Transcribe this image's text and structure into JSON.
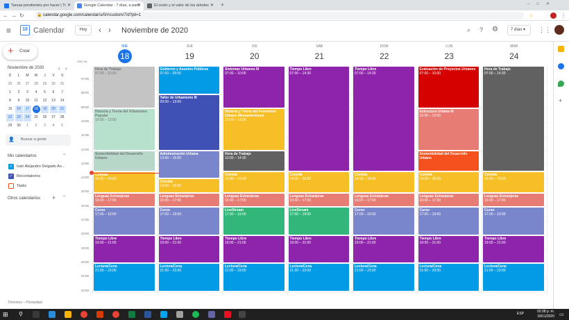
{
  "browser": {
    "tabs": [
      {
        "title": "Tareas pendientes por hacer | Tr"
      },
      {
        "title": "Google Calendar - 7 días, a parti"
      },
      {
        "title": "El costo y el valor de los árboles"
      }
    ],
    "url": "calendar.google.com/calendar/u/0/r/custom/7/d?pli=1"
  },
  "header": {
    "app": "Calendar",
    "today": "Hoy",
    "prev": "‹",
    "next": "›",
    "title": "Noviembre de 2020",
    "view": "7 días"
  },
  "sidebar": {
    "create": "Crear",
    "mini_title": "Noviembre de 2020",
    "weekdays": [
      "D",
      "L",
      "M",
      "M",
      "J",
      "V",
      "S"
    ],
    "weeks": [
      [
        "25",
        "26",
        "27",
        "28",
        "29",
        "30",
        "31"
      ],
      [
        "1",
        "2",
        "3",
        "4",
        "5",
        "6",
        "7"
      ],
      [
        "8",
        "9",
        "10",
        "11",
        "12",
        "13",
        "14"
      ],
      [
        "15",
        "16",
        "17",
        "18",
        "19",
        "20",
        "21"
      ],
      [
        "22",
        "23",
        "24",
        "25",
        "26",
        "27",
        "28"
      ],
      [
        "29",
        "30",
        "1",
        "2",
        "3",
        "4",
        "5"
      ]
    ],
    "search": "Buscar a gente",
    "my_calendars": "Mis calendarios",
    "cals": [
      "Iván Alejandro Delgado An...",
      "Recordatorios",
      "Tasks"
    ],
    "other_calendars": "Otros calendarios",
    "footer": "Términos – Privacidad"
  },
  "tz": "GMT-06",
  "days": [
    {
      "name": "MIÉ",
      "num": "18"
    },
    {
      "name": "JUE",
      "num": "19"
    },
    {
      "name": "VIE",
      "num": "20"
    },
    {
      "name": "SÁB",
      "num": "21"
    },
    {
      "name": "DOM",
      "num": "22"
    },
    {
      "name": "LUN",
      "num": "23"
    },
    {
      "name": "MAR",
      "num": "24"
    }
  ],
  "times": [
    "07:00",
    "08:00",
    "09:00",
    "10:00",
    "11:00",
    "12:00",
    "13:00",
    "14:00",
    "15:00",
    "16:00",
    "17:00",
    "18:00",
    "19:00",
    "20:00",
    "21:00",
    "22:00"
  ],
  "events": [
    {
      "day": 0,
      "start": 7,
      "end": 10,
      "title": "Hora de Trabajo",
      "time": "07:00 – 10:00",
      "color": "#c4c4c4",
      "faded": true
    },
    {
      "day": 0,
      "start": 10,
      "end": 13,
      "title": "Historia y Teoría del Urbanismo Popular",
      "time": "10:00 – 13:00",
      "color": "#b7e1cd",
      "faded": true
    },
    {
      "day": 0,
      "start": 13,
      "end": 14.5,
      "title": "Sostenibilidad del Desarrollo Urbano",
      "time": "",
      "color": "#b7d7c8",
      "faded": true
    },
    {
      "day": 0,
      "start": 14.5,
      "end": 16,
      "title": "Comida",
      "time": "14:30 – 16:00",
      "color": "#f6bf26"
    },
    {
      "day": 0,
      "start": 16,
      "end": 17,
      "title": "Lenguas Extranjeras",
      "time": "16:00 – 17:00",
      "color": "#e67c73"
    },
    {
      "day": 0,
      "start": 17,
      "end": 19,
      "title": "Curso",
      "time": "17:00 – 19:00",
      "color": "#7986cb"
    },
    {
      "day": 0,
      "start": 19,
      "end": 21,
      "title": "Tiempo Libre",
      "time": "19:00 – 21:00",
      "color": "#8e24aa"
    },
    {
      "day": 0,
      "start": 21,
      "end": 23,
      "title": "Lectura/Cena",
      "time": "21:00 – 23:00",
      "color": "#039be5"
    },
    {
      "day": 1,
      "start": 7,
      "end": 9,
      "title": "Gobierno y Asuntos Públicos",
      "time": "07:00 – 09:00",
      "color": "#039be5"
    },
    {
      "day": 1,
      "start": 9,
      "end": 13,
      "title": "Taller de Urbanismo III",
      "time": "09:00 – 13:00",
      "color": "#3f51b5"
    },
    {
      "day": 1,
      "start": 13,
      "end": 15,
      "title": "Administración Urbana",
      "time": "13:00 – 15:00",
      "color": "#7986cb"
    },
    {
      "day": 1,
      "start": 15,
      "end": 16,
      "title": "Comida",
      "time": "14:30 – 16:00",
      "color": "#f6bf26"
    },
    {
      "day": 1,
      "start": 16,
      "end": 17,
      "title": "Lenguas Extranjeras",
      "time": "16:00 – 17:00",
      "color": "#e67c73"
    },
    {
      "day": 1,
      "start": 17,
      "end": 19,
      "title": "Curso",
      "time": "17:00 – 19:00",
      "color": "#7986cb"
    },
    {
      "day": 1,
      "start": 19,
      "end": 21,
      "title": "Tiempo Libre",
      "time": "19:00 – 21:00",
      "color": "#8e24aa"
    },
    {
      "day": 1,
      "start": 21,
      "end": 23,
      "title": "Lectura/Cena",
      "time": "21:00 – 23:00",
      "color": "#039be5"
    },
    {
      "day": 2,
      "start": 7,
      "end": 10,
      "title": "Sistemas Urbanos III",
      "time": "07:00 – 10:00",
      "color": "#8e24aa"
    },
    {
      "day": 2,
      "start": 10,
      "end": 13,
      "title": "Historia y Teoría del Fenómeno Urbano Mesoamericano",
      "time": "10:00 – 13:00",
      "color": "#f6bf26"
    },
    {
      "day": 2,
      "start": 13,
      "end": 14.5,
      "title": "Hora de Trabajo",
      "time": "13:00 – 14:30",
      "color": "#616161"
    },
    {
      "day": 2,
      "start": 14.5,
      "end": 16,
      "title": "Comida",
      "time": "14:30 – 16:00",
      "color": "#f6bf26"
    },
    {
      "day": 2,
      "start": 16,
      "end": 17,
      "title": "Lenguas Extranjeras",
      "time": "16:00 – 17:00",
      "color": "#e67c73"
    },
    {
      "day": 2,
      "start": 17,
      "end": 19,
      "title": "LiveStream",
      "time": "17:00 – 19:00",
      "color": "#33b679"
    },
    {
      "day": 2,
      "start": 19,
      "end": 21,
      "title": "Tiempo Libre",
      "time": "19:00 – 21:00",
      "color": "#8e24aa"
    },
    {
      "day": 2,
      "start": 21,
      "end": 23,
      "title": "Lectura/Cena",
      "time": "21:00 – 23:00",
      "color": "#039be5"
    },
    {
      "day": 3,
      "start": 7,
      "end": 14.5,
      "title": "Tiempo Libre",
      "time": "07:00 – 14:30",
      "color": "#8e24aa"
    },
    {
      "day": 3,
      "start": 14.5,
      "end": 16,
      "title": "Comida",
      "time": "14:30 – 16:00",
      "color": "#f6bf26"
    },
    {
      "day": 3,
      "start": 16,
      "end": 17,
      "title": "Lenguas Extranjeras",
      "time": "16:00 – 17:00",
      "color": "#e67c73"
    },
    {
      "day": 3,
      "start": 17,
      "end": 19,
      "title": "LiveStream",
      "time": "17:00 – 19:00",
      "color": "#33b679"
    },
    {
      "day": 3,
      "start": 19,
      "end": 21,
      "title": "Tiempo Libre",
      "time": "19:00 – 21:00",
      "color": "#8e24aa"
    },
    {
      "day": 3,
      "start": 21,
      "end": 23,
      "title": "Lectura/Cena",
      "time": "21:00 – 23:00",
      "color": "#039be5"
    },
    {
      "day": 4,
      "start": 7,
      "end": 14.5,
      "title": "Tiempo Libre",
      "time": "07:00 – 14:30",
      "color": "#8e24aa"
    },
    {
      "day": 4,
      "start": 14.5,
      "end": 16,
      "title": "Comida",
      "time": "14:30 – 16:00",
      "color": "#f6bf26"
    },
    {
      "day": 4,
      "start": 16,
      "end": 17,
      "title": "Lenguas Extranjeras",
      "time": "16:00 – 17:00",
      "color": "#e67c73"
    },
    {
      "day": 4,
      "start": 17,
      "end": 19,
      "title": "Curso",
      "time": "17:00 – 19:00",
      "color": "#7986cb"
    },
    {
      "day": 4,
      "start": 19,
      "end": 21,
      "title": "Tiempo Libre",
      "time": "19:00 – 21:00",
      "color": "#8e24aa"
    },
    {
      "day": 4,
      "start": 21,
      "end": 23,
      "title": "Lectura/Cena",
      "time": "21:00 – 23:00",
      "color": "#039be5"
    },
    {
      "day": 5,
      "start": 7,
      "end": 10,
      "title": "Evaluación de Proyectos Urbanos",
      "time": "07:00 – 10:00",
      "color": "#d50000"
    },
    {
      "day": 5,
      "start": 10,
      "end": 13,
      "title": "Estructura Urbana III",
      "time": "10:00 – 13:00",
      "color": "#e67c73"
    },
    {
      "day": 5,
      "start": 13,
      "end": 14.5,
      "title": "Sostenibilidad del Desarrollo Urbano",
      "time": "",
      "color": "#f4511e"
    },
    {
      "day": 5,
      "start": 14.5,
      "end": 16,
      "title": "Comida",
      "time": "14:30 – 16:00",
      "color": "#f6bf26"
    },
    {
      "day": 5,
      "start": 16,
      "end": 17,
      "title": "Lenguas Extranjeras",
      "time": "16:00 – 17:00",
      "color": "#e67c73"
    },
    {
      "day": 5,
      "start": 17,
      "end": 19,
      "title": "Curso",
      "time": "17:00 – 19:00",
      "color": "#7986cb"
    },
    {
      "day": 5,
      "start": 19,
      "end": 21,
      "title": "Tiempo Libre",
      "time": "19:00 – 21:00",
      "color": "#8e24aa"
    },
    {
      "day": 5,
      "start": 21,
      "end": 23,
      "title": "Lectura/Cena",
      "time": "21:00 – 23:00",
      "color": "#039be5"
    },
    {
      "day": 6,
      "start": 7,
      "end": 14.5,
      "title": "Hora de Trabajo",
      "time": "07:00 – 14:30",
      "color": "#616161"
    },
    {
      "day": 6,
      "start": 14.5,
      "end": 16,
      "title": "Comida",
      "time": "14:30 – 16:00",
      "color": "#f6bf26"
    },
    {
      "day": 6,
      "start": 16,
      "end": 17,
      "title": "Lenguas Extranjeras",
      "time": "16:00 – 17:00",
      "color": "#e67c73"
    },
    {
      "day": 6,
      "start": 17,
      "end": 19,
      "title": "Curso",
      "time": "17:00 – 19:00",
      "color": "#7986cb"
    },
    {
      "day": 6,
      "start": 19,
      "end": 21,
      "title": "Tiempo Libre",
      "time": "19:00 – 21:00",
      "color": "#8e24aa"
    },
    {
      "day": 6,
      "start": 21,
      "end": 23,
      "title": "Lectura/Cena",
      "time": "21:00 – 23:00",
      "color": "#039be5"
    }
  ],
  "taskbar": {
    "time": "02:38 p. m.",
    "date": "18/11/2020",
    "lang": "ESP"
  }
}
